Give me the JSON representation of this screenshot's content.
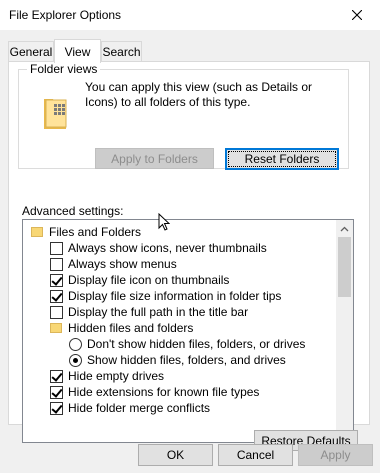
{
  "window": {
    "title": "File Explorer Options"
  },
  "tabs": [
    {
      "label": "General"
    },
    {
      "label": "View"
    },
    {
      "label": "Search"
    }
  ],
  "folder_views": {
    "legend": "Folder views",
    "description": "You can apply this view (such as Details or Icons) to all folders of this type.",
    "apply_button": "Apply to Folders",
    "reset_button": "Reset Folders"
  },
  "advanced": {
    "label": "Advanced settings:",
    "items": [
      {
        "type": "folder",
        "label": "Files and Folders"
      },
      {
        "type": "checkbox",
        "label": "Always show icons, never thumbnails",
        "checked": false
      },
      {
        "type": "checkbox",
        "label": "Always show menus",
        "checked": false
      },
      {
        "type": "checkbox",
        "label": "Display file icon on thumbnails",
        "checked": true
      },
      {
        "type": "checkbox",
        "label": "Display file size information in folder tips",
        "checked": true
      },
      {
        "type": "checkbox",
        "label": "Display the full path in the title bar",
        "checked": false
      },
      {
        "type": "folder",
        "label": "Hidden files and folders"
      },
      {
        "type": "radio",
        "label": "Don't show hidden files, folders, or drives",
        "checked": false
      },
      {
        "type": "radio",
        "label": "Show hidden files, folders, and drives",
        "checked": true
      },
      {
        "type": "checkbox",
        "label": "Hide empty drives",
        "checked": true
      },
      {
        "type": "checkbox",
        "label": "Hide extensions for known file types",
        "checked": true
      },
      {
        "type": "checkbox",
        "label": "Hide folder merge conflicts",
        "checked": true
      }
    ]
  },
  "restore_button": "Restore Defaults",
  "footer": {
    "ok": "OK",
    "cancel": "Cancel",
    "apply": "Apply"
  }
}
